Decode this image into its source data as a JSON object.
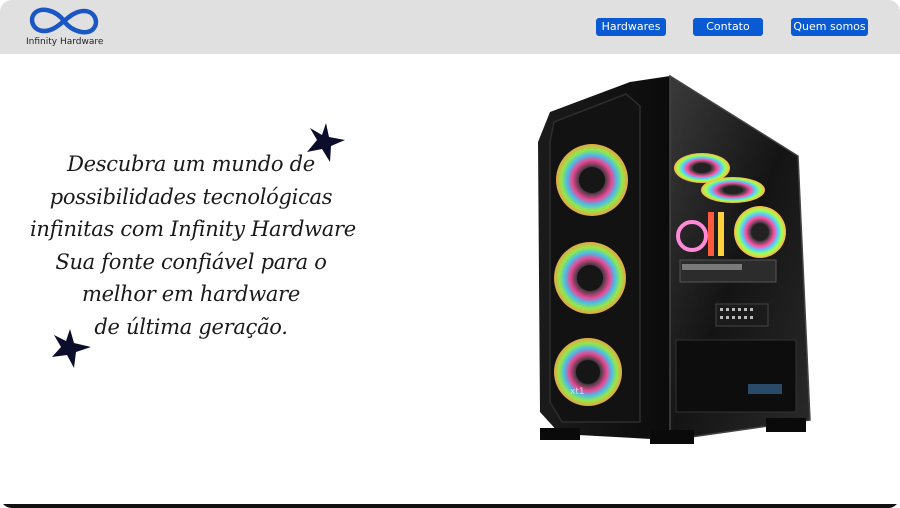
{
  "brand": {
    "name": "Infinity Hardware",
    "logo_icon": "infinity-icon",
    "accent_color": "#0a5bd3"
  },
  "nav": {
    "items": [
      {
        "label": "Hardwares"
      },
      {
        "label": "Contato"
      },
      {
        "label": "Quem somos"
      }
    ]
  },
  "hero": {
    "lines": [
      "Descubra um mundo de",
      "possibilidades tecnológicas",
      "infinitas com Infinity Hardware",
      "Sua fonte confiável para o",
      "melhor em hardware",
      "de última geração."
    ],
    "decor_icons": [
      "star-icon",
      "star-icon"
    ],
    "image": "gaming-pc-case-image"
  }
}
